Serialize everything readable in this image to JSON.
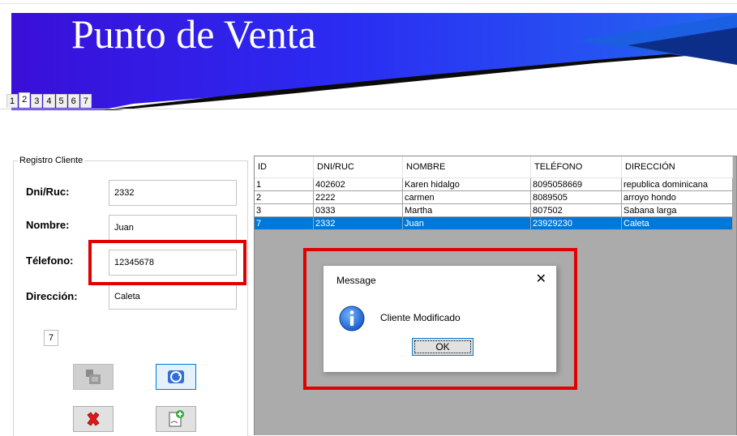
{
  "banner": {
    "title": "Punto de Venta"
  },
  "tabs": [
    {
      "label": "1"
    },
    {
      "label": "2",
      "active": true
    },
    {
      "label": "3"
    },
    {
      "label": "4"
    },
    {
      "label": "5"
    },
    {
      "label": "6"
    },
    {
      "label": "7"
    }
  ],
  "form": {
    "legend": "Registro Cliente",
    "dni_label": "Dni/Ruc:",
    "dni_value": "2332",
    "nombre_label": "Nombre:",
    "nombre_value": "Juan",
    "telefono_label": "Télefono:",
    "telefono_value": "12345678",
    "direccion_label": "Dirección:",
    "direccion_value": "Caleta",
    "id_value": "7"
  },
  "table": {
    "headers": [
      "ID",
      "DNI/RUC",
      "NOMBRE",
      "TELÉFONO",
      "DIRECCIÓN"
    ],
    "rows": [
      [
        "1",
        "402602",
        "Karen hidalgo",
        "8095058669",
        "republica dominicana"
      ],
      [
        "2",
        "2222",
        "carmen",
        "8089505",
        "arroyo hondo"
      ],
      [
        "3",
        "0333",
        "Martha",
        "807502",
        "Sabana larga"
      ],
      [
        "7",
        "2332",
        "Juan",
        "23929230",
        "Caleta"
      ]
    ],
    "selected_row": 3
  },
  "dialog": {
    "title": "Message",
    "close_glyph": "✕",
    "message": "Cliente Modificado",
    "ok_label": "OK"
  },
  "colors": {
    "banner_blue": "#2a1ff0",
    "selection": "#0078d7",
    "highlight": "#e00000"
  }
}
